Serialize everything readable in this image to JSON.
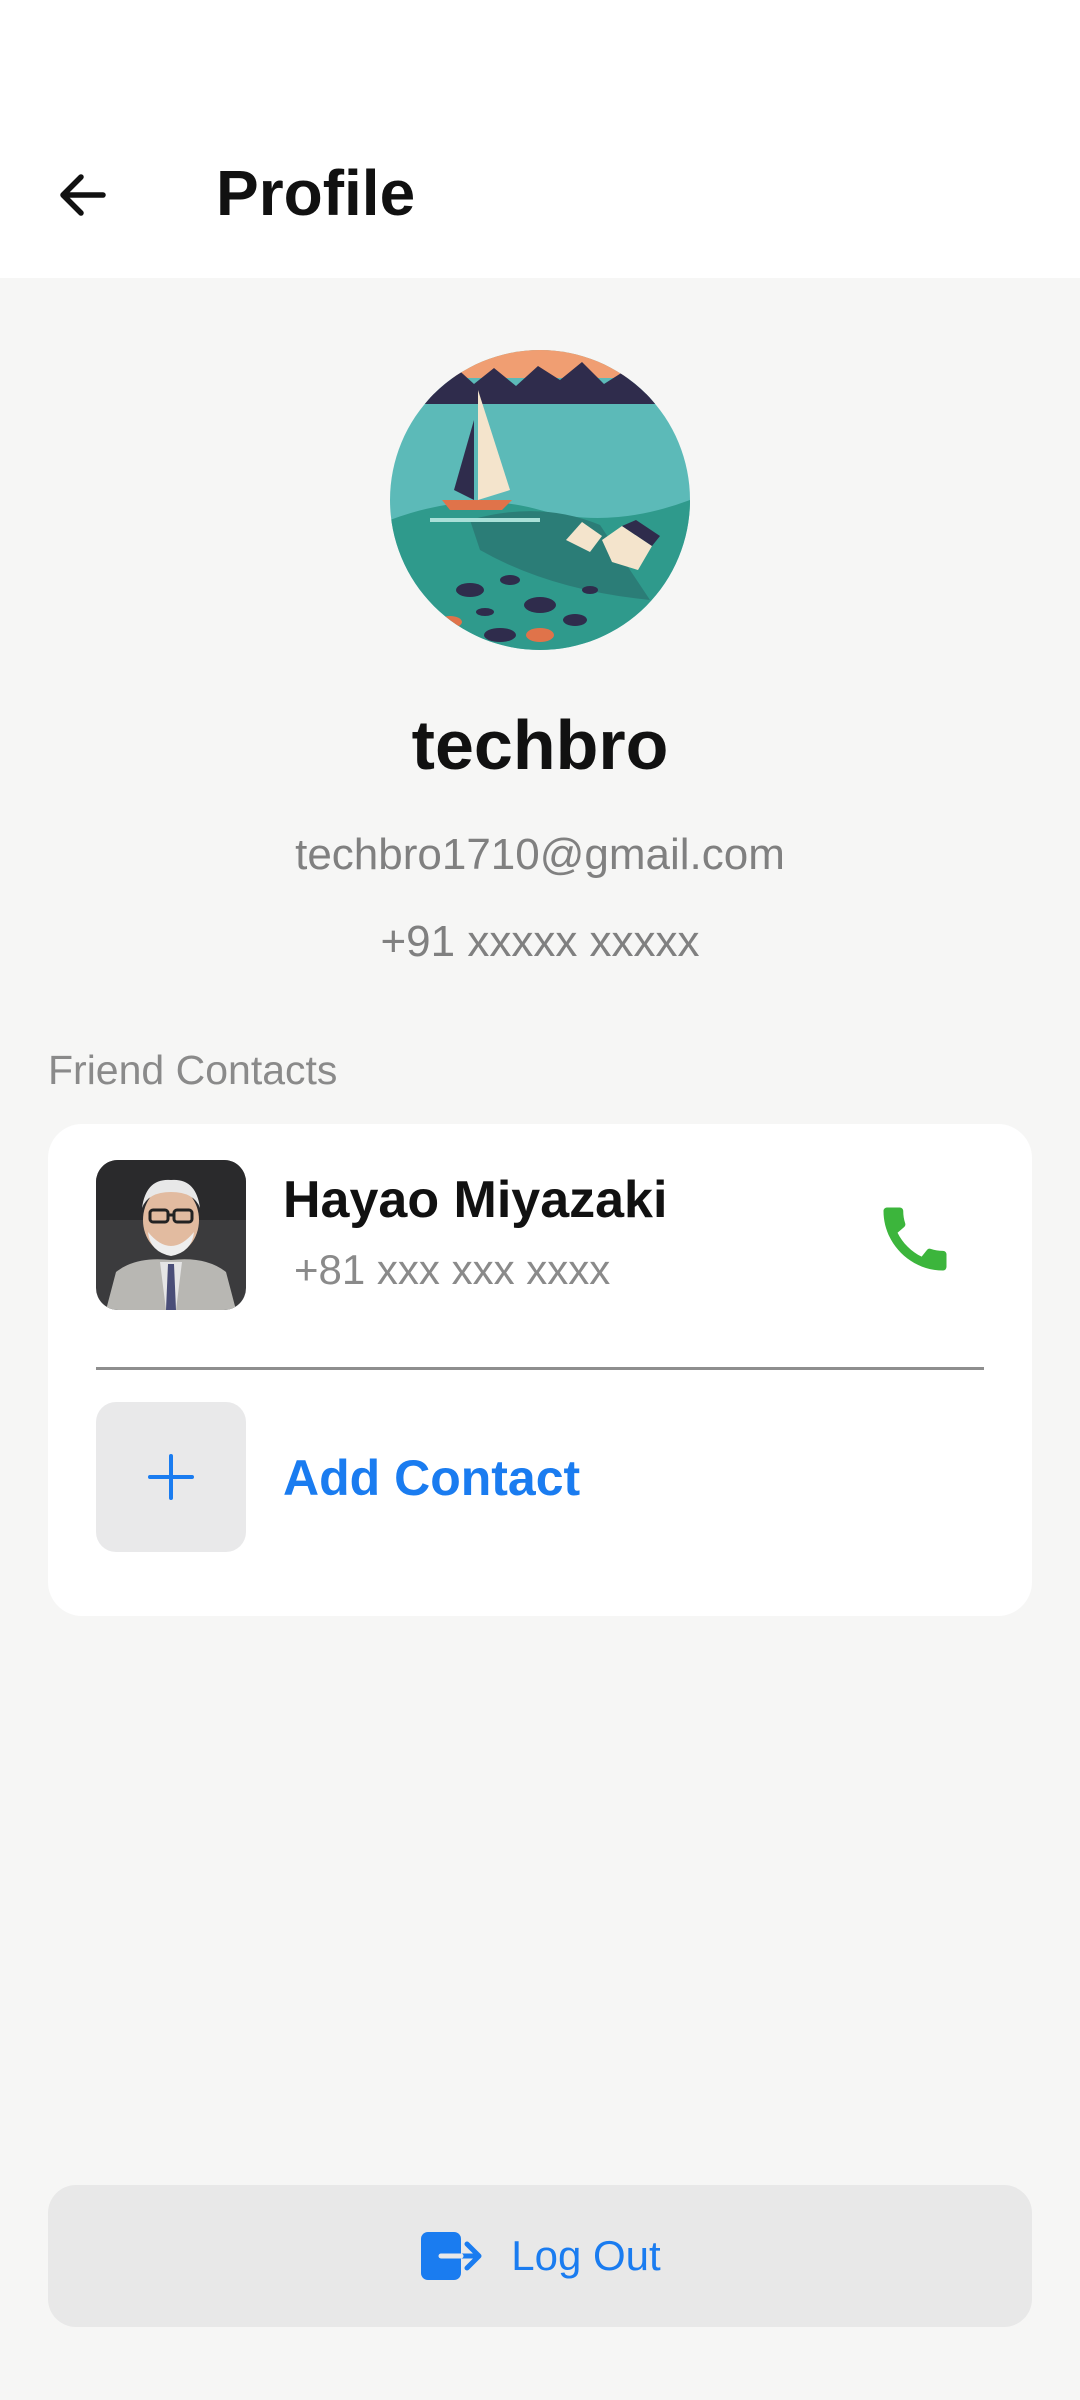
{
  "header": {
    "title": "Profile",
    "back_icon": "arrow-left-icon"
  },
  "profile": {
    "avatar_icon": "sailboat-illustration",
    "username": "techbro",
    "email": "techbro1710@gmail.com",
    "phone": "+91 xxxxx xxxxx"
  },
  "contacts": {
    "section_label": "Friend Contacts",
    "items": [
      {
        "name": "Hayao Miyazaki",
        "phone": "+81 xxx xxx xxxx",
        "action_icon": "phone-icon"
      }
    ],
    "add_label": "Add Contact",
    "add_icon": "plus-icon"
  },
  "logout": {
    "label": "Log Out",
    "icon": "logout-icon"
  },
  "colors": {
    "accent": "#1a7cf0",
    "call_green": "#3cb53c",
    "background": "#f6f6f5",
    "muted_text": "#808080"
  }
}
